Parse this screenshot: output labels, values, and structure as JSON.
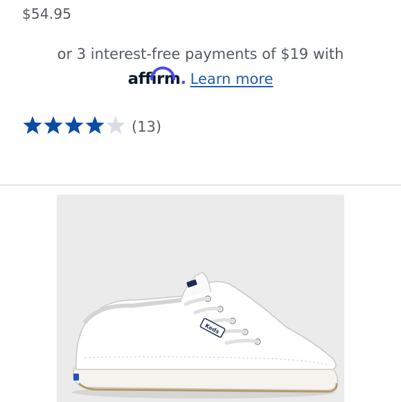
{
  "product": {
    "price": "$54.95",
    "financing": {
      "text": "or 3 interest-free payments of $19 with",
      "provider_logo_text": "affirm",
      "provider_logo_dot": ".",
      "learn_more_label": "Learn more"
    },
    "rating": {
      "value": 4,
      "max": 5,
      "review_count_label": "(13)"
    },
    "image": {
      "description_icon": "shoe-image",
      "brand_tag": "Keds"
    }
  },
  "colors": {
    "star_filled": "#0b4da2",
    "star_empty": "#d9dde3",
    "link": "#1f5bb5",
    "text": "#555a60",
    "affirm_accent": "#4a4af4"
  }
}
